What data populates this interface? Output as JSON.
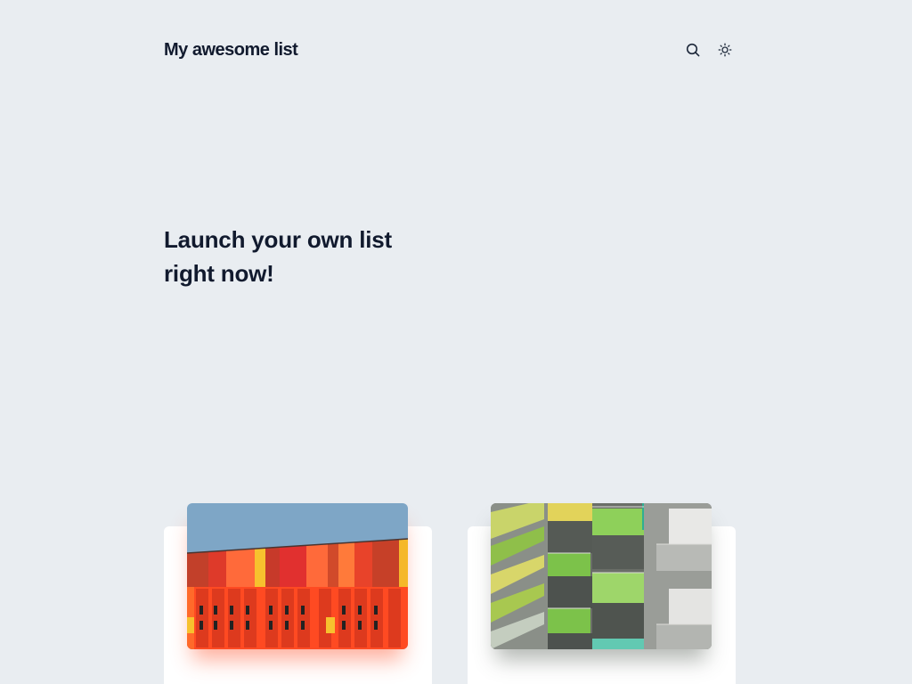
{
  "header": {
    "title": "My awesome list",
    "search_icon": "search-icon",
    "theme_icon": "sun-icon"
  },
  "hero": {
    "line1": "Launch your own list",
    "line2": "right now!"
  },
  "colors": {
    "background": "#e9edf1",
    "text": "#111a2e",
    "card": "#ffffff"
  }
}
